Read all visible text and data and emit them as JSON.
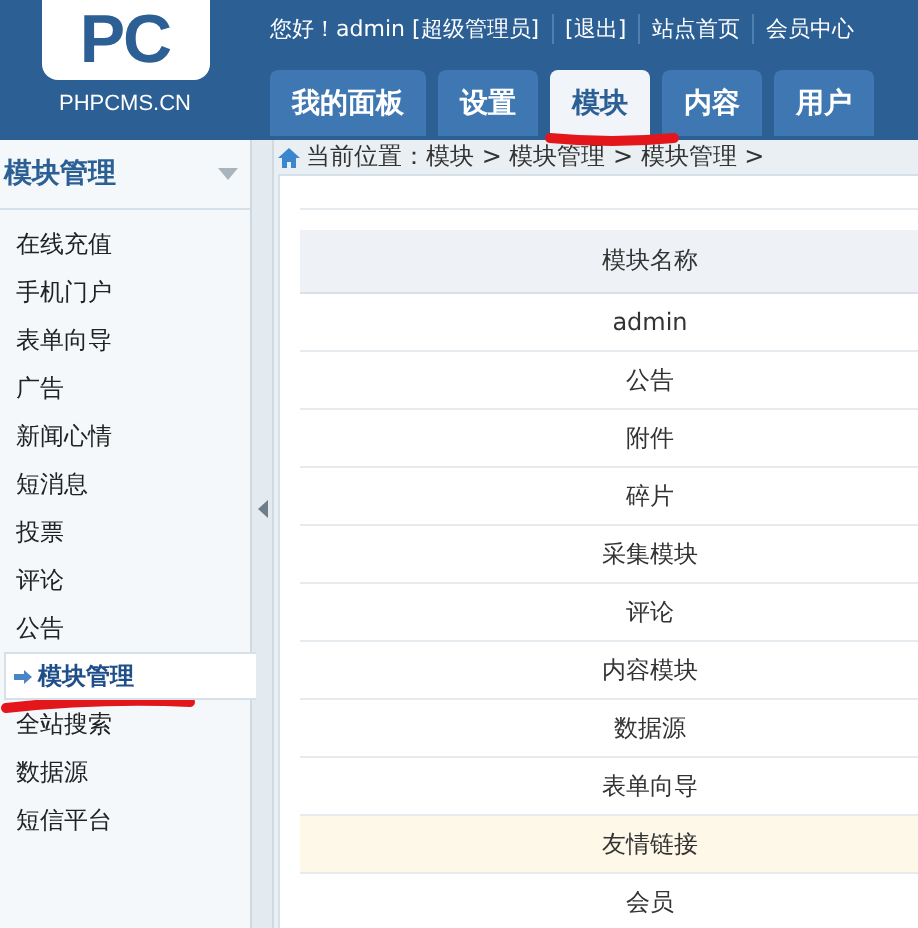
{
  "logo": {
    "mark": "PC",
    "site": "PHPCMS.CN"
  },
  "top_links": [
    {
      "text": "您好！admin [超级管理员]"
    },
    {
      "text": "[退出]"
    },
    {
      "text": "站点首页"
    },
    {
      "text": "会员中心"
    }
  ],
  "tabs": [
    {
      "label": "我的面板",
      "selected": false
    },
    {
      "label": "设置",
      "selected": false
    },
    {
      "label": "模块",
      "selected": true
    },
    {
      "label": "内容",
      "selected": false
    },
    {
      "label": "用户",
      "selected": false
    }
  ],
  "sidebar": {
    "title": "模块管理",
    "items": [
      {
        "label": "在线充值",
        "selected": false
      },
      {
        "label": "手机门户",
        "selected": false
      },
      {
        "label": "表单向导",
        "selected": false
      },
      {
        "label": "广告",
        "selected": false
      },
      {
        "label": "新闻心情",
        "selected": false
      },
      {
        "label": "短消息",
        "selected": false
      },
      {
        "label": "投票",
        "selected": false
      },
      {
        "label": "评论",
        "selected": false
      },
      {
        "label": "公告",
        "selected": false
      },
      {
        "label": "模块管理",
        "selected": true
      },
      {
        "label": "全站搜索",
        "selected": false
      },
      {
        "label": "数据源",
        "selected": false
      },
      {
        "label": "短信平台",
        "selected": false
      }
    ]
  },
  "breadcrumb": "当前位置：模块 > 模块管理 > 模块管理 >",
  "table": {
    "columns": [
      "模块名称"
    ],
    "rows": [
      {
        "name": "admin",
        "highlighted": false
      },
      {
        "name": "公告",
        "highlighted": false
      },
      {
        "name": "附件",
        "highlighted": false
      },
      {
        "name": "碎片",
        "highlighted": false
      },
      {
        "name": "采集模块",
        "highlighted": false
      },
      {
        "name": "评论",
        "highlighted": false
      },
      {
        "name": "内容模块",
        "highlighted": false
      },
      {
        "name": "数据源",
        "highlighted": false
      },
      {
        "name": "表单向导",
        "highlighted": false
      },
      {
        "name": "友情链接",
        "highlighted": true
      },
      {
        "name": "会员",
        "highlighted": false
      }
    ]
  }
}
